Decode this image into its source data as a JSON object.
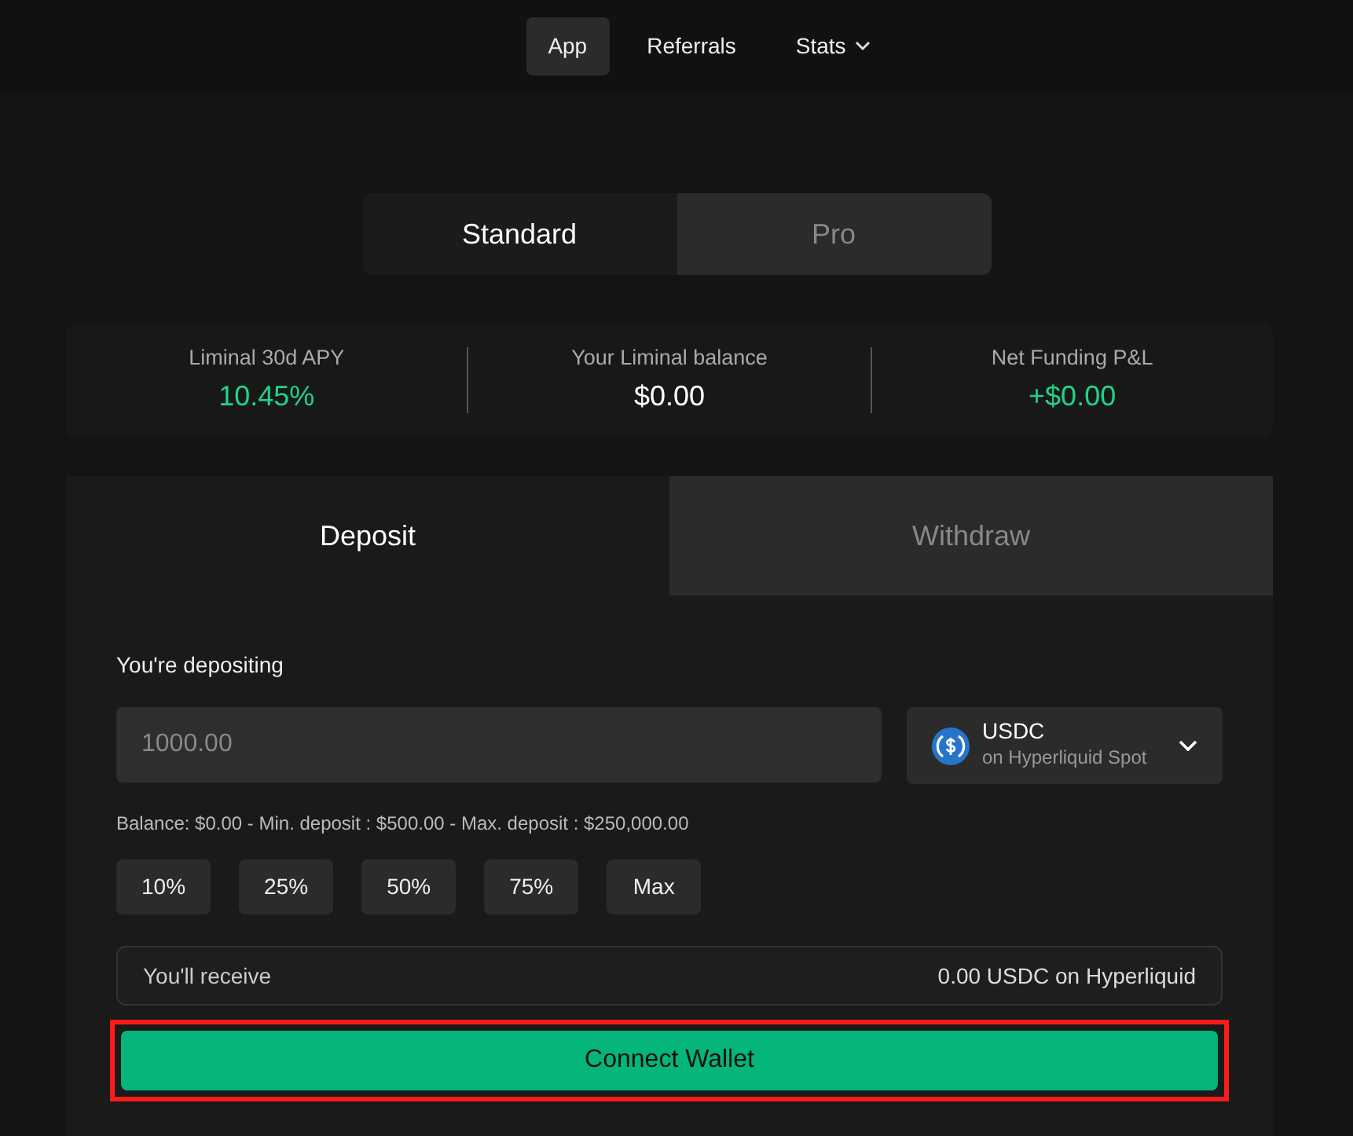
{
  "nav": [
    {
      "label": "App",
      "selected": true,
      "dropdown": false
    },
    {
      "label": "Referrals",
      "selected": false,
      "dropdown": false
    },
    {
      "label": "Stats",
      "selected": false,
      "dropdown": true
    }
  ],
  "mode_tabs": [
    {
      "label": "Standard",
      "selected": true
    },
    {
      "label": "Pro",
      "selected": false
    }
  ],
  "stats": [
    {
      "label": "Liminal 30d APY",
      "value": "10.45%",
      "positive": true
    },
    {
      "label": "Your Liminal balance",
      "value": "$0.00",
      "positive": false
    },
    {
      "label": "Net Funding P&L",
      "value": "+$0.00",
      "positive": true
    }
  ],
  "action_tabs": [
    {
      "label": "Deposit",
      "selected": true
    },
    {
      "label": "Withdraw",
      "selected": false
    }
  ],
  "form": {
    "label": "You're depositing",
    "amount": {
      "placeholder": "1000.00"
    },
    "token": {
      "symbol": "USDC",
      "network": "on Hyperliquid Spot"
    },
    "limits": "Balance: $0.00 - Min. deposit : $500.00 - Max. deposit : $250,000.00",
    "presets": [
      "10%",
      "25%",
      "50%",
      "75%",
      "Max"
    ],
    "receive": {
      "label": "You'll receive",
      "value": "0.00 USDC on Hyperliquid"
    },
    "button": {
      "label": "Connect Wallet",
      "highlighted": true
    }
  }
}
